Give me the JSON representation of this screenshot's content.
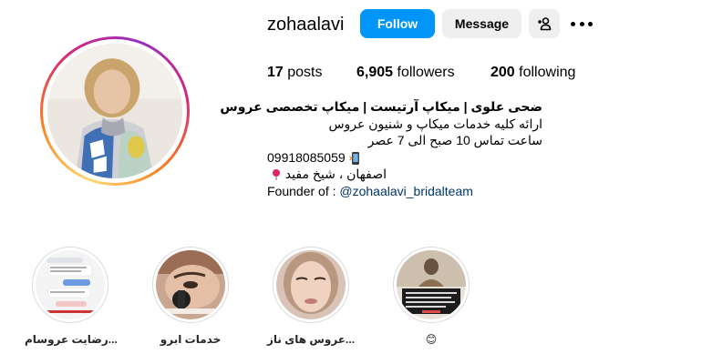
{
  "profile": {
    "username": "zohaalavi",
    "follow_label": "Follow",
    "message_label": "Message"
  },
  "stats": {
    "posts_count": "17",
    "posts_label": "posts",
    "followers_count": "6,905",
    "followers_label": "followers",
    "following_count": "200",
    "following_label": "following"
  },
  "bio": {
    "name": "ضحی علوی | میکاپ آرتیست | میکاپ تخصصی عروس",
    "line1": "ارائه کلیه خدمات میکاپ و شنیون عروس",
    "line2": "ساعت تماس 10 صبح الی 7 عصر",
    "phone": "09918085059",
    "location": "اصفهان ، شیخ مفید",
    "founder_prefix": "Founder of : ",
    "founder_link": "@zohaalavi_bridalteam"
  },
  "highlights": [
    {
      "label": "رضایت عروسام..."
    },
    {
      "label": "خدمات ابرو"
    },
    {
      "label": "عروس های ناز..."
    },
    {
      "label": "😊"
    }
  ],
  "colors": {
    "follow_button": "#0095f6",
    "secondary_button": "#efefef",
    "link": "#00376b"
  },
  "icons": {
    "add_user": "add-person-icon",
    "more": "more-options-icon",
    "phone": "mobile-phone-icon",
    "location": "location-pin-icon"
  }
}
